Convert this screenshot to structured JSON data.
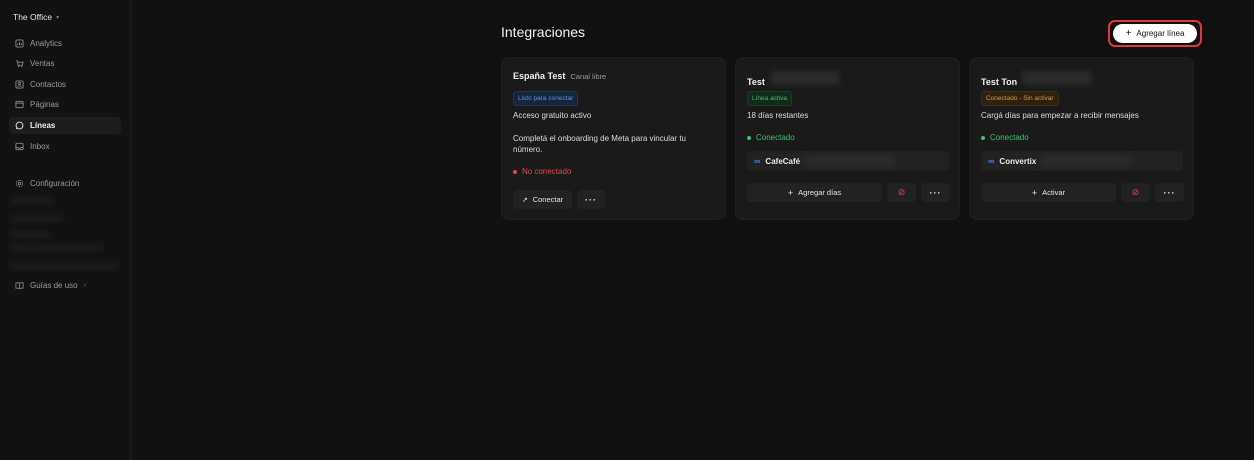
{
  "sidebar": {
    "workspace": "The Office",
    "items": [
      {
        "label": "Analytics",
        "icon": "chart-icon"
      },
      {
        "label": "Ventas",
        "icon": "cart-icon"
      },
      {
        "label": "Contactos",
        "icon": "contacts-icon"
      },
      {
        "label": "Páginas",
        "icon": "pages-icon"
      },
      {
        "label": "Líneas",
        "icon": "whatsapp-icon"
      },
      {
        "label": "Inbox",
        "icon": "inbox-icon"
      }
    ],
    "settings": "Configuración",
    "guides": "Guías de uso"
  },
  "main": {
    "title": "Integraciones",
    "add_button": "Agregar línea",
    "cards": [
      {
        "title": "España Test",
        "subtitle": "Canal libre",
        "badge": "Listo para conectar",
        "line1": "Acceso gratuito activo",
        "line2": "Completá el onboarding de Meta para vincular tu número.",
        "status": "No conectado",
        "button": "Conectar"
      },
      {
        "title": "Test",
        "badge": "Línea activa",
        "line1": "18 días restantes",
        "status": "Conectado",
        "account": "CafeCafé",
        "button": "Agregar días"
      },
      {
        "title": "Test Ton",
        "badge": "Conectado - Sin activar",
        "line1": "Cargá días para empezar a recibir mensajes",
        "status": "Conectado",
        "account": "Convertix",
        "button": "Activar"
      }
    ]
  },
  "colors": {
    "background": "#101010",
    "card": "#1a1a1a",
    "accent_red": "#e0363f",
    "status_green": "#3fbf6f",
    "status_red": "#e0464e"
  }
}
